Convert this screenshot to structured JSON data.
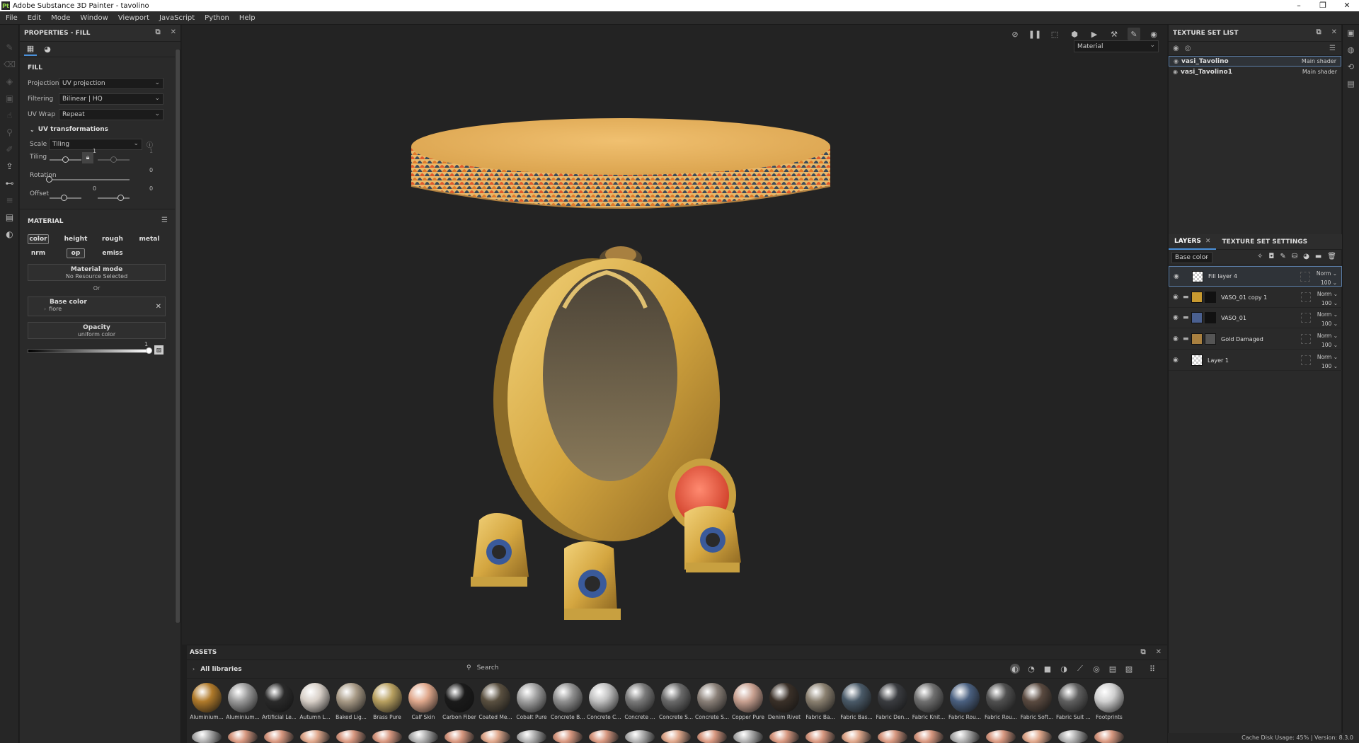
{
  "window": {
    "title": "Adobe Substance 3D Painter - tavolino",
    "logo": "Pt"
  },
  "menu": [
    "File",
    "Edit",
    "Mode",
    "Window",
    "Viewport",
    "JavaScript",
    "Python",
    "Help"
  ],
  "properties": {
    "header": "PROPERTIES - FILL",
    "fill_title": "FILL",
    "projection_label": "Projection",
    "projection_value": "UV projection",
    "filtering_label": "Filtering",
    "filtering_value": "Bilinear | HQ",
    "uvwrap_label": "UV Wrap",
    "uvwrap_value": "Repeat",
    "uvtrans_title": "UV transformations",
    "scale_label": "Scale",
    "scale_value": "Tiling",
    "tiling_label": "Tiling",
    "tiling_value_a": "1",
    "tiling_value_b": "1",
    "rotation_label": "Rotation",
    "rotation_value": "0",
    "offset_label": "Offset",
    "offset_value_a": "0",
    "offset_value_b": "0",
    "material_title": "MATERIAL",
    "channels": [
      "color",
      "height",
      "rough",
      "metal",
      "nrm",
      "op",
      "emiss"
    ],
    "material_mode_label": "Material mode",
    "material_mode_value": "No Resource Selected",
    "or_label": "Or",
    "base_color_label": "Base color",
    "base_color_value": "fiore",
    "opacity_label": "Opacity",
    "opacity_value": "uniform color",
    "opacity_level": "1"
  },
  "viewport": {
    "material_select": "Material"
  },
  "texture_set": {
    "header": "TEXTURE SET LIST",
    "items": [
      {
        "name": "vasi_Tavolino",
        "shader": "Main shader"
      },
      {
        "name": "vasi_Tavolino1",
        "shader": "Main shader"
      }
    ]
  },
  "layers": {
    "tab_layers": "LAYERS",
    "tab_settings": "TEXTURE SET SETTINGS",
    "channel_select": "Base color",
    "items": [
      {
        "name": "Fill layer 4",
        "blend": "Norm",
        "opacity": "100"
      },
      {
        "name": "VASO_01 copy 1",
        "blend": "Norm",
        "opacity": "100"
      },
      {
        "name": "VASO_01",
        "blend": "Norm",
        "opacity": "100"
      },
      {
        "name": "Gold Damaged",
        "blend": "Norm",
        "opacity": "100"
      },
      {
        "name": "Layer 1",
        "blend": "Norm",
        "opacity": "100"
      }
    ]
  },
  "assets": {
    "header": "ASSETS",
    "libraries": "All libraries",
    "search_placeholder": "Search",
    "items": [
      {
        "name": "Aluminium...",
        "color": "#b07a2a"
      },
      {
        "name": "Aluminium...",
        "color": "#9a9a9a"
      },
      {
        "name": "Artificial Le...",
        "color": "#2a2a2a"
      },
      {
        "name": "Autumn L...",
        "color": "#d8d0c8"
      },
      {
        "name": "Baked Lig...",
        "color": "#a89a86"
      },
      {
        "name": "Brass Pure",
        "color": "#b8a060"
      },
      {
        "name": "Calf Skin",
        "color": "#e0a88c"
      },
      {
        "name": "Carbon Fiber",
        "color": "#1a1a1a"
      },
      {
        "name": "Coated Me...",
        "color": "#5a5040"
      },
      {
        "name": "Cobalt Pure",
        "color": "#a0a0a0"
      },
      {
        "name": "Concrete B...",
        "color": "#909090"
      },
      {
        "name": "Concrete C...",
        "color": "#c0c0c0"
      },
      {
        "name": "Concrete ...",
        "color": "#7a7a7a"
      },
      {
        "name": "Concrete S...",
        "color": "#6a6a6a"
      },
      {
        "name": "Concrete S...",
        "color": "#8a8078"
      },
      {
        "name": "Copper Pure",
        "color": "#c8a090"
      },
      {
        "name": "Denim Rivet",
        "color": "#3a3028"
      },
      {
        "name": "Fabric Ba...",
        "color": "#8a8070"
      },
      {
        "name": "Fabric Bas...",
        "color": "#4a5a68"
      },
      {
        "name": "Fabric Den...",
        "color": "#3a3c40"
      },
      {
        "name": "Fabric Knit...",
        "color": "#707070"
      },
      {
        "name": "Fabric Rou...",
        "color": "#4a6080"
      },
      {
        "name": "Fabric Rou...",
        "color": "#505050"
      },
      {
        "name": "Fabric Soft...",
        "color": "#5a4a40"
      },
      {
        "name": "Fabric Suit ...",
        "color": "#606060"
      },
      {
        "name": "Footprints",
        "color": "#d0d0d0"
      }
    ]
  },
  "status": {
    "text": "Cache Disk Usage:  45% | Version: 8.3.0"
  }
}
